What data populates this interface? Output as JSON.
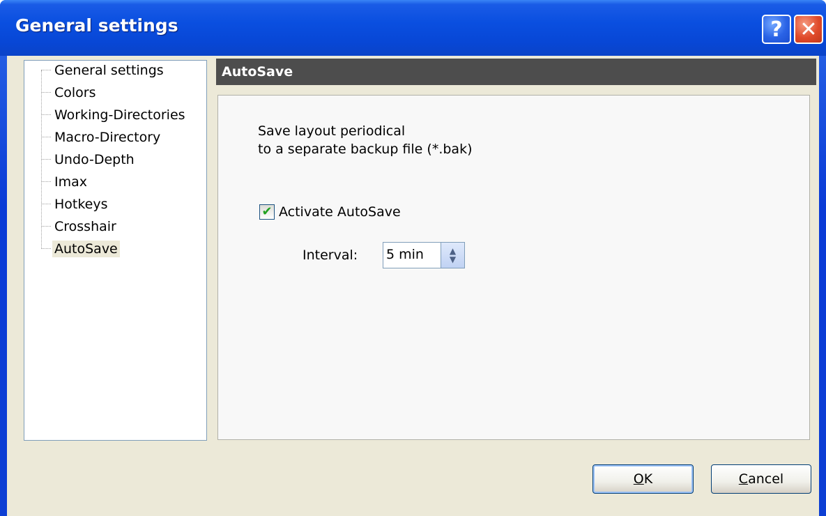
{
  "window": {
    "title": "General settings",
    "help_symbol": "?",
    "close_symbol": "✕"
  },
  "tree": {
    "items": [
      {
        "label": "General settings",
        "selected": false
      },
      {
        "label": "Colors",
        "selected": false
      },
      {
        "label": "Working-Directories",
        "selected": false
      },
      {
        "label": "Macro-Directory",
        "selected": false
      },
      {
        "label": "Undo-Depth",
        "selected": false
      },
      {
        "label": "Imax",
        "selected": false
      },
      {
        "label": "Hotkeys",
        "selected": false
      },
      {
        "label": "Crosshair",
        "selected": false
      },
      {
        "label": "AutoSave",
        "selected": true
      }
    ]
  },
  "section": {
    "header": "AutoSave",
    "description_line1": "Save layout periodical",
    "description_line2": "to  a separate backup file (*.bak)",
    "checkbox_label": "Activate AutoSave",
    "checkbox_checked": true,
    "interval_label": "Interval:",
    "interval_value": "5 min"
  },
  "buttons": {
    "ok_mnemonic": "O",
    "ok_rest": "K",
    "cancel_mnemonic": "C",
    "cancel_rest": "ancel"
  },
  "colors": {
    "titlebar": "#0a4fe0",
    "dialog_bg": "#ece9d8",
    "header_bar": "#4d4d4d",
    "check_green": "#21a121",
    "close_red": "#e04a2a"
  }
}
